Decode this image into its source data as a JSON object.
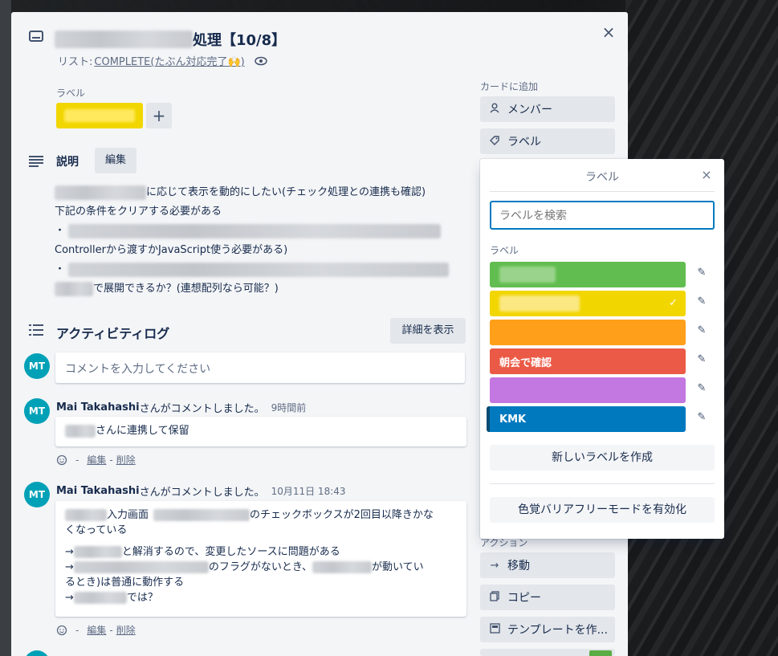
{
  "card": {
    "title_suffix": "処理【10/8】",
    "list_prefix": "リスト: ",
    "list_name": "COMPLETE(たぶん対応完了🙌)",
    "close_glyph": "×",
    "labels_heading": "ラベル",
    "add_label_glyph": "+"
  },
  "description": {
    "heading": "説明",
    "edit_label": "編集",
    "line1": "に応じて表示を動的にしたい(チェック処理との連携も確認)",
    "line2": "下記の条件をクリアする必要がある",
    "bullet": "・",
    "line4": "Controllerから渡すかJavaScript使う必要がある)",
    "line6": "で展開できるか？(連想配列なら可能？)"
  },
  "activity": {
    "heading": "アクティビティログ",
    "details_label": "詳細を表示",
    "comment_placeholder": "コメントを入力してください",
    "avatar_initials": "MT",
    "comments": [
      {
        "author": "Mai Takahashi",
        "action": "さんがコメントしました。",
        "time": "9時間前",
        "text": "さんに連携して保留"
      },
      {
        "author": "Mai Takahashi",
        "action": "さんがコメントしました。",
        "time": "10月11日 18:43",
        "l1a": "入力画面",
        "l1b": "のチェックボックスが2回目以降きかな",
        "l2": "くなっている",
        "l3a": "→",
        "l3b": "と解消するので、変更したソースに問題がある",
        "l4a": "→",
        "l4b": "のフラグがないとき、",
        "l4c": "が動いてい",
        "l5": "るとき)は普通に動作する",
        "l6a": "→",
        "l6b": "では？"
      }
    ],
    "edit_link": "編集",
    "delete_link": "削除",
    "dash": "-"
  },
  "sidebar": {
    "add_to_card": "カードに追加",
    "members": "メンバー",
    "labels": "ラベル",
    "actions_heading": "アクション",
    "move": "移動",
    "copy": "コピー",
    "template": "テンプレートを作..."
  },
  "label_popover": {
    "title": "ラベル",
    "close_glyph": "×",
    "search_placeholder": "ラベルを検索",
    "section_label": "ラベル",
    "labels": [
      {
        "name": "",
        "color": "#61bd4f"
      },
      {
        "name": "",
        "color": "#f2d600",
        "selected": true
      },
      {
        "name": "",
        "color": "#ff9f1a"
      },
      {
        "name": "朝会で確認",
        "color": "#eb5a46"
      },
      {
        "name": "",
        "color": "#c377e0"
      },
      {
        "name": "KMK",
        "color": "#0079bf"
      }
    ],
    "create_label": "新しいラベルを作成",
    "colorblind_mode": "色覚バリアフリーモードを有効化"
  }
}
